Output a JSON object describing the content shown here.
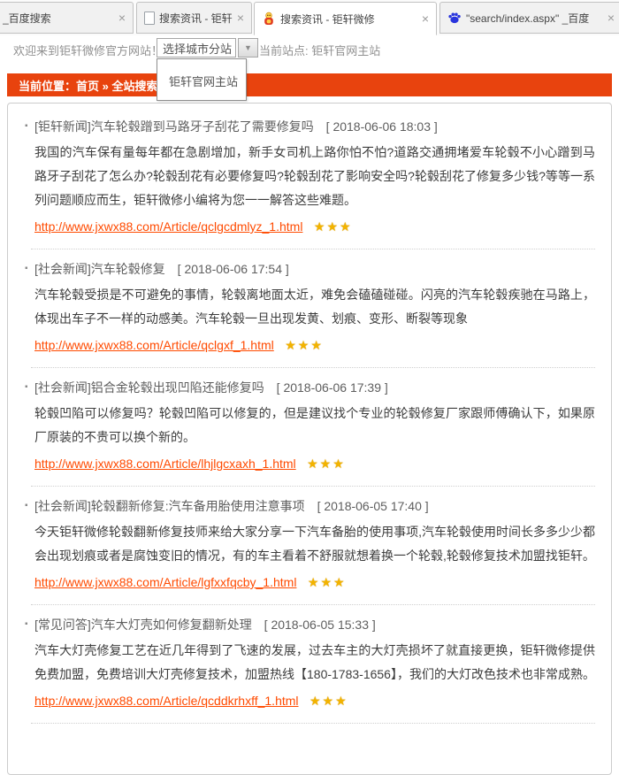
{
  "colors": {
    "accent_orange": "#e8430e",
    "link_orange": "#ff4a00",
    "star_gold": "#f2b300",
    "tab_inactive_bg": "#f1f1f1",
    "tab_border": "#c2c2c2"
  },
  "icons": {
    "close": "×",
    "dropdown_caret": "▼",
    "bullet": "▪",
    "page_icon": "blank-page",
    "mascot_icon": "red-yellow-mascot",
    "baidu_icon": "blue-paw"
  },
  "tabs": [
    {
      "label": "_百度搜索",
      "close": "×"
    },
    {
      "label": "搜索资讯 - 钜轩微修",
      "close": "×"
    },
    {
      "label": "搜索资讯 - 钜轩微修",
      "close": "×"
    },
    {
      "label": "\"search/index.aspx\" _百度",
      "close": "×"
    }
  ],
  "header": {
    "welcome": "欢迎来到钜轩微修官方网站！",
    "city_select_label": "选择城市分站",
    "current_site": "当前站点: 钜轩官网主站",
    "dropdown_item": "钜轩官网主站"
  },
  "breadcrumb": {
    "text": "当前位置：首页 » 全站搜索"
  },
  "results": [
    {
      "category": "[钜轩新闻]",
      "title": "汽车轮毂蹭到马路牙子刮花了需要修复吗",
      "date": "[ 2018-06-06 18:03 ]",
      "body": "我国的汽车保有量每年都在急剧增加，新手女司机上路你怕不怕?道路交通拥堵爱车轮毂不小心蹭到马路牙子刮花了怎么办?轮毂刮花有必要修复吗?轮毂刮花了影响安全吗?轮毂刮花了修复多少钱?等等一系列问题顺应而生，钜轩微修小编将为您一一解答这些难题。",
      "link": "http://www.jxwx88.com/Article/qclgcdmlyz_1.html",
      "stars": "★★★"
    },
    {
      "category": "[社会新闻]",
      "title": "汽车轮毂修复",
      "date": "[ 2018-06-06 17:54 ]",
      "body": "汽车轮毂受损是不可避免的事情，轮毂离地面太近，难免会磕磕碰碰。闪亮的汽车轮毂疾驰在马路上，体现出车子不一样的动感美。汽车轮毂一旦出现发黄、划痕、变形、断裂等现象",
      "link": "http://www.jxwx88.com/Article/qclgxf_1.html",
      "stars": "★★★"
    },
    {
      "category": "[社会新闻]",
      "title": "铝合金轮毂出现凹陷还能修复吗",
      "date": "[ 2018-06-06 17:39 ]",
      "body": "轮毂凹陷可以修复吗？轮毂凹陷可以修复的，但是建议找个专业的轮毂修复厂家跟师傅确认下，如果原厂原装的不贵可以换个新的。",
      "link": "http://www.jxwx88.com/Article/lhjlgcxaxh_1.html",
      "stars": "★★★"
    },
    {
      "category": "[社会新闻]",
      "title": "轮毂翻新修复:汽车备用胎使用注意事项",
      "date": "[ 2018-06-05 17:40 ]",
      "body": "今天钜轩微修轮毂翻新修复技师来给大家分享一下汽车备胎的使用事项,汽车轮毂使用时间长多多少少都会出现划痕或者是腐蚀变旧的情况，有的车主看着不舒服就想着换一个轮毂,轮毂修复技术加盟找钜轩。",
      "link": "http://www.jxwx88.com/Article/lgfxxfqcby_1.html",
      "stars": "★★★"
    },
    {
      "category": "[常见问答]",
      "title": "汽车大灯壳如何修复翻新处理",
      "date": "[ 2018-06-05 15:33 ]",
      "body": "汽车大灯壳修复工艺在近几年得到了飞速的发展，过去车主的大灯壳损坏了就直接更换，钜轩微修提供免费加盟，免费培训大灯壳修复技术，加盟热线【180-1783-1656】，我们的大灯改色技术也非常成熟。",
      "link": "http://www.jxwx88.com/Article/qcddkrhxff_1.html",
      "stars": "★★★"
    }
  ]
}
